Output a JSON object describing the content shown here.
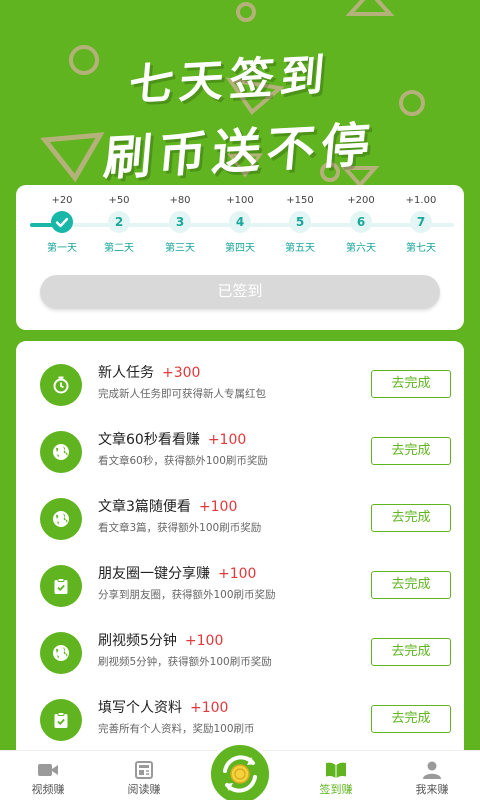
{
  "hero": {
    "title_line1": "七天签到",
    "title_line2": "刷币送不停"
  },
  "checkin": {
    "days": [
      {
        "bonus": "+20",
        "num": "",
        "label": "第一天",
        "done": true
      },
      {
        "bonus": "+50",
        "num": "2",
        "label": "第二天",
        "done": false
      },
      {
        "bonus": "+80",
        "num": "3",
        "label": "第三天",
        "done": false
      },
      {
        "bonus": "+100",
        "num": "4",
        "label": "第四天",
        "done": false
      },
      {
        "bonus": "+150",
        "num": "5",
        "label": "第五天",
        "done": false
      },
      {
        "bonus": "+200",
        "num": "6",
        "label": "第六天",
        "done": false
      },
      {
        "bonus": "+1.00",
        "num": "7",
        "label": "第七天",
        "done": false
      }
    ],
    "button_label": "已签到"
  },
  "tasks": [
    {
      "name": "新人任务",
      "points": "+300",
      "desc": "完成新人任务即可获得新人专属红包",
      "action": "去完成",
      "icon": "stopwatch-icon"
    },
    {
      "name": "文章60秒看看赚",
      "points": "+100",
      "desc": "看文章60秒，获得额外100刷币奖励",
      "action": "去完成",
      "icon": "globe-icon"
    },
    {
      "name": "文章3篇随便看",
      "points": "+100",
      "desc": "看文章3篇，获得额外100刷币奖励",
      "action": "去完成",
      "icon": "globe-icon"
    },
    {
      "name": "朋友圈一键分享赚",
      "points": "+100",
      "desc": "分享到朋友圈，获得额外100刷币奖励",
      "action": "去完成",
      "icon": "clipboard-check-icon"
    },
    {
      "name": "刷视频5分钟",
      "points": "+100",
      "desc": "刷视频5分钟，获得额外100刷币奖励",
      "action": "去完成",
      "icon": "globe-icon"
    },
    {
      "name": "填写个人资料",
      "points": "+100",
      "desc": "完善所有个人资料，奖励100刷币",
      "action": "去完成",
      "icon": "clipboard-check-icon"
    }
  ],
  "tabbar": {
    "items": [
      {
        "label": "视频赚",
        "icon": "video-camera-icon",
        "active": false
      },
      {
        "label": "阅读赚",
        "icon": "newspaper-icon",
        "active": false
      },
      {
        "label": "签到赚",
        "icon": "open-book-icon",
        "active": true
      },
      {
        "label": "我来赚",
        "icon": "user-icon",
        "active": false
      }
    ],
    "center_icon": "coin-refresh-icon"
  },
  "colors": {
    "brand_green": "#5fb41f",
    "teal": "#18b7a8",
    "points_red": "#e0393b",
    "disabled_gray": "#d9d9d9"
  }
}
